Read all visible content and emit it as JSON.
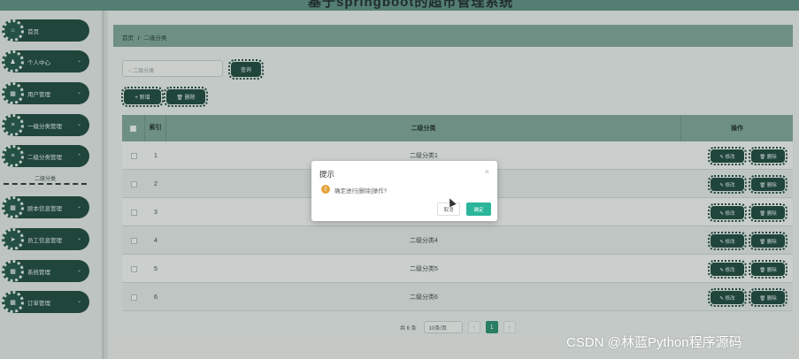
{
  "header": {
    "title": "基于springboot的超市管理系统"
  },
  "sidebar": {
    "items": [
      {
        "label": "首页",
        "icon": "home-icon",
        "glyph": "⌂",
        "expandable": false
      },
      {
        "label": "个人中心",
        "icon": "user-icon",
        "glyph": "♟",
        "expandable": true
      },
      {
        "label": "用户管理",
        "icon": "grid-icon",
        "glyph": "▦",
        "expandable": true
      },
      {
        "label": "一级分类管理",
        "icon": "list-icon",
        "glyph": "≡",
        "expandable": true
      },
      {
        "label": "二级分类管理",
        "icon": "list-icon",
        "glyph": "≡",
        "expandable": true
      },
      {
        "label": "顾本信息管理",
        "icon": "grid-icon",
        "glyph": "▦",
        "expandable": true
      },
      {
        "label": "员工信息管理",
        "icon": "send-icon",
        "glyph": "➤",
        "expandable": true
      },
      {
        "label": "系统管理",
        "icon": "grid-icon",
        "glyph": "▦",
        "expandable": true
      },
      {
        "label": "订单管理",
        "icon": "grid-icon",
        "glyph": "▦",
        "expandable": true
      }
    ],
    "chevron": "⌄",
    "sub_item": "二级分类"
  },
  "breadcrumb": {
    "home": "首页",
    "separator": "/",
    "current": "二级分类"
  },
  "search": {
    "placeholder": "○ 二级分类",
    "button": "查询"
  },
  "toolbar": {
    "add": "+ 新增",
    "delete": "🗑 删除"
  },
  "table": {
    "columns": {
      "index": "索引",
      "name": "二级分类",
      "actions": "操作"
    },
    "rows": [
      {
        "index": "1",
        "name": "二级分类1"
      },
      {
        "index": "2",
        "name": ""
      },
      {
        "index": "3",
        "name": ""
      },
      {
        "index": "4",
        "name": "二级分类4"
      },
      {
        "index": "5",
        "name": "二级分类5"
      },
      {
        "index": "6",
        "name": "二级分类6"
      }
    ],
    "edit_label": "✎ 修改",
    "delete_label": "🗑 删除"
  },
  "pagination": {
    "total": "共 6 条",
    "page_size": "10条/页",
    "prev": "‹",
    "current": "1",
    "next": "›"
  },
  "dialog": {
    "title": "提示",
    "close": "×",
    "warn_glyph": "!",
    "message": "确定进行[删除]操作?",
    "cancel": "取消",
    "confirm": "确定"
  },
  "watermark": "CSDN @林蓝Python程序源码",
  "colors": {
    "accent": "#1f4a3f",
    "header": "#7ea598",
    "confirm": "#2bb59a",
    "warning": "#e6a23c"
  }
}
